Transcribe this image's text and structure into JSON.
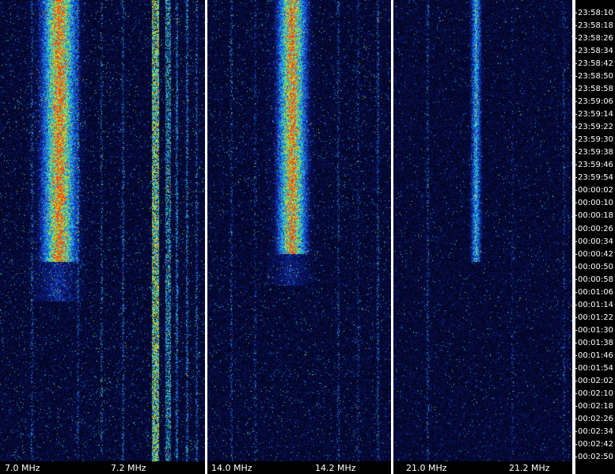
{
  "panels": [
    {
      "id": "band-40m",
      "freq_labels": [
        "7.0 MHz",
        "7.2 MHz"
      ]
    },
    {
      "id": "band-20m",
      "freq_labels": [
        "14.0 MHz",
        "14.2 MHz"
      ]
    },
    {
      "id": "band-15m",
      "freq_labels": [
        "21.0 MHz",
        "21.2 MHz"
      ]
    }
  ],
  "time_labels": [
    "23:58:10",
    "23:58:18",
    "23:58:26",
    "23:58:34",
    "23:58:42",
    "23:58:50",
    "23:58:58",
    "23:59:06",
    "23:59:14",
    "23:59:22",
    "23:59:30",
    "23:59:38",
    "23:59:46",
    "23:59:54",
    "00:00:02",
    "00:00:10",
    "00:00:18",
    "00:00:26",
    "00:00:34",
    "00:00:42",
    "00:00:50",
    "00:00:58",
    "00:01:06",
    "00:01:14",
    "00:01:22",
    "00:01:30",
    "00:01:38",
    "00:01:46",
    "00:01:54",
    "00:02:02",
    "00:02:10",
    "00:02:18",
    "00:02:26",
    "00:02:34",
    "00:02:42",
    "00:02:50"
  ],
  "colors": {
    "background": "#000000",
    "low": "#0a1a6e",
    "mid": "#1e8cff",
    "high": "#ff2a00",
    "text": "#ffffff"
  }
}
